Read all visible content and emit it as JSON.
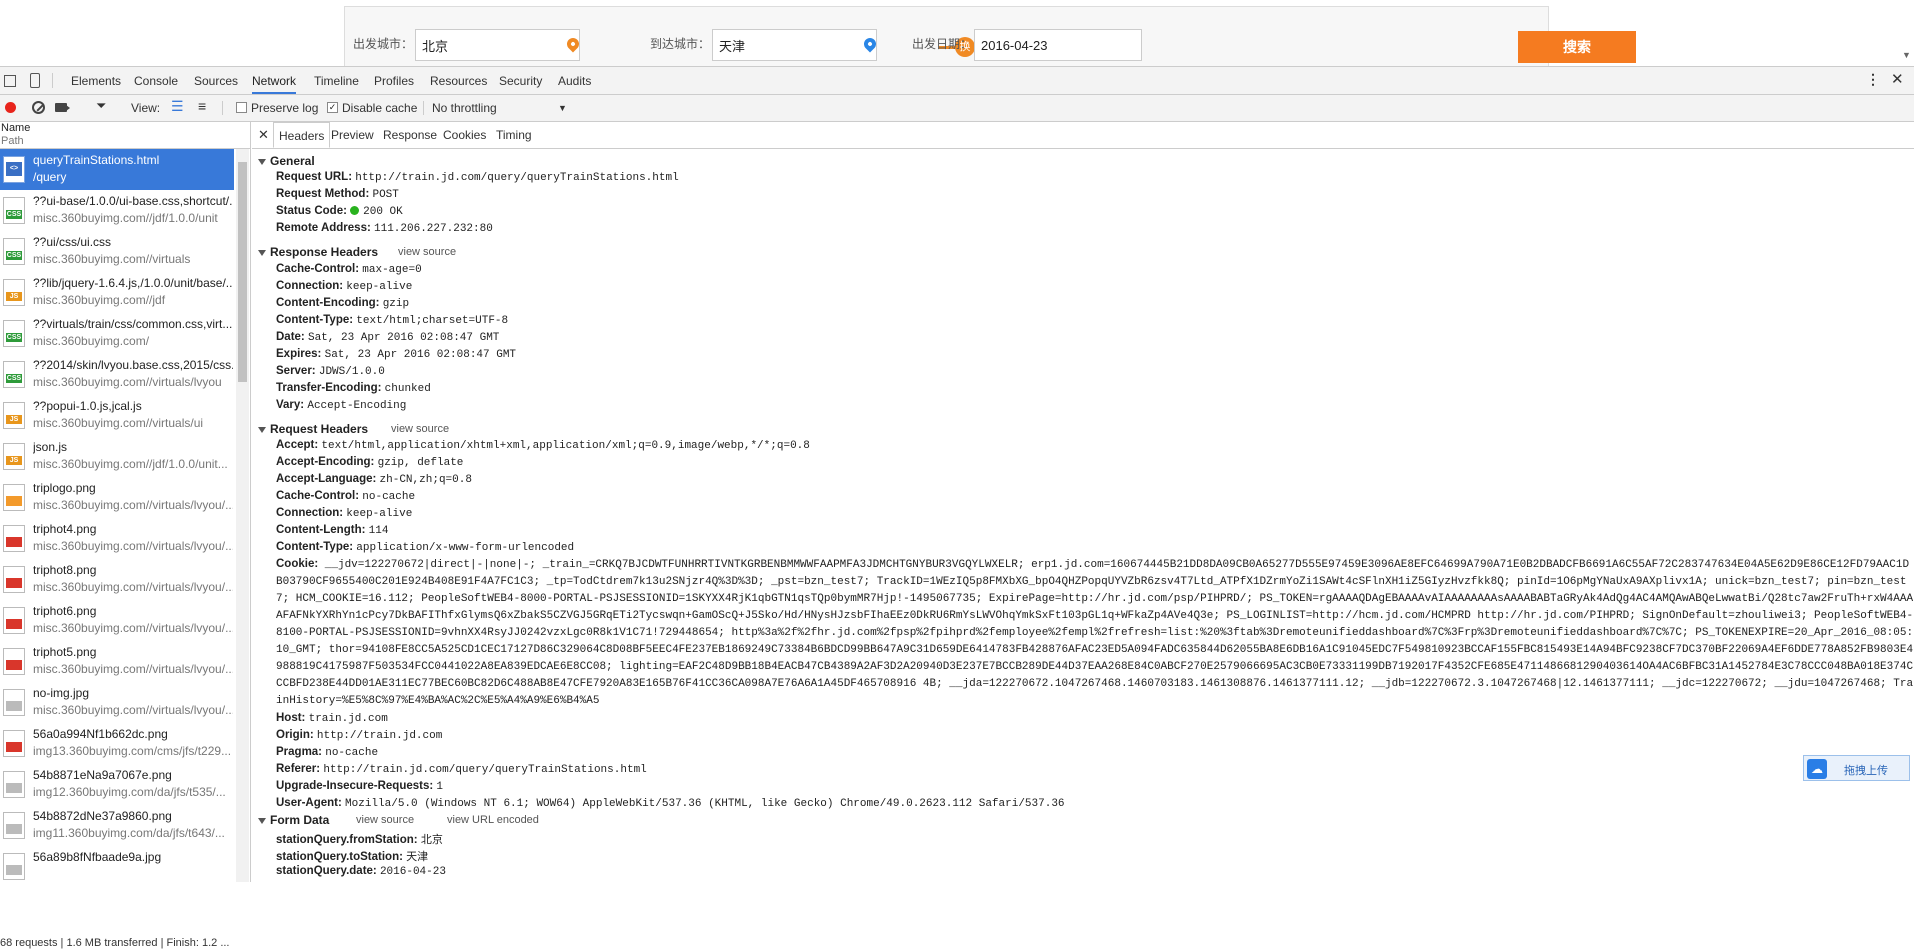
{
  "search": {
    "from_label": "出发城市：",
    "from_value": "北京",
    "swap_label": "换",
    "to_label": "到达城市：",
    "to_value": "天津",
    "date_label": "出发日期：",
    "date_value": "2016-04-23",
    "button_label": "搜索"
  },
  "devtools": {
    "tabs": [
      "Elements",
      "Console",
      "Sources",
      "Network",
      "Timeline",
      "Profiles",
      "Resources",
      "Security",
      "Audits"
    ],
    "active_tab": "Network",
    "toolbar": {
      "view_label": "View:",
      "preserve_log": "Preserve log",
      "disable_cache": "Disable cache",
      "throttling": "No throttling"
    },
    "list_header": {
      "name": "Name",
      "path": "Path"
    },
    "requests": [
      {
        "name": "queryTrainStations.html",
        "path": "/query",
        "type": "html"
      },
      {
        "name": "??ui-base/1.0.0/ui-base.css,shortcut/...",
        "path": "misc.360buyimg.com//jdf/1.0.0/unit",
        "type": "css"
      },
      {
        "name": "??ui/css/ui.css",
        "path": "misc.360buyimg.com//virtuals",
        "type": "css"
      },
      {
        "name": "??lib/jquery-1.6.4.js,/1.0.0/unit/base/...",
        "path": "misc.360buyimg.com//jdf",
        "type": "js"
      },
      {
        "name": "??virtuals/train/css/common.css,virt...",
        "path": "misc.360buyimg.com/",
        "type": "css"
      },
      {
        "name": "??2014/skin/lvyou.base.css,2015/css...",
        "path": "misc.360buyimg.com//virtuals/lvyou",
        "type": "css"
      },
      {
        "name": "??popui-1.0.js,jcal.js",
        "path": "misc.360buyimg.com//virtuals/ui",
        "type": "js"
      },
      {
        "name": "json.js",
        "path": "misc.360buyimg.com//jdf/1.0.0/unit...",
        "type": "js"
      },
      {
        "name": "triplogo.png",
        "path": "misc.360buyimg.com//virtuals/lvyou/...",
        "type": "img-orange"
      },
      {
        "name": "triphot4.png",
        "path": "misc.360buyimg.com//virtuals/lvyou/...",
        "type": "img-red"
      },
      {
        "name": "triphot8.png",
        "path": "misc.360buyimg.com//virtuals/lvyou/...",
        "type": "img-red"
      },
      {
        "name": "triphot6.png",
        "path": "misc.360buyimg.com//virtuals/lvyou/...",
        "type": "img-red"
      },
      {
        "name": "triphot5.png",
        "path": "misc.360buyimg.com//virtuals/lvyou/...",
        "type": "img-red"
      },
      {
        "name": "no-img.jpg",
        "path": "misc.360buyimg.com//virtuals/lvyou/...",
        "type": "img-gray"
      },
      {
        "name": "56a0a994Nf1b662dc.png",
        "path": "img13.360buyimg.com/cms/jfs/t229...",
        "type": "img-red"
      },
      {
        "name": "54b8871eNa9a7067e.png",
        "path": "img12.360buyimg.com/da/jfs/t535/...",
        "type": "img-gray"
      },
      {
        "name": "54b8872dNe37a9860.png",
        "path": "img11.360buyimg.com/da/jfs/t643/...",
        "type": "img-gray"
      },
      {
        "name": "56a89b8fNfbaade9a.jpg",
        "path": "",
        "type": "img-gray"
      }
    ],
    "status": "68 requests  |  1.6 MB transferred  |  Finish: 1.2 ...",
    "detail_tabs": [
      "Headers",
      "Preview",
      "Response",
      "Cookies",
      "Timing"
    ],
    "general": {
      "title": "General",
      "request_url": {
        "k": "Request URL:",
        "v": "http://train.jd.com/query/queryTrainStations.html"
      },
      "request_method": {
        "k": "Request Method:",
        "v": "POST"
      },
      "status_code": {
        "k": "Status Code:",
        "v": "200 OK"
      },
      "remote_address": {
        "k": "Remote Address:",
        "v": "111.206.227.232:80"
      }
    },
    "response_headers": {
      "title": "Response Headers",
      "view_source": "view source",
      "items": [
        {
          "k": "Cache-Control:",
          "v": "max-age=0"
        },
        {
          "k": "Connection:",
          "v": "keep-alive"
        },
        {
          "k": "Content-Encoding:",
          "v": "gzip"
        },
        {
          "k": "Content-Type:",
          "v": "text/html;charset=UTF-8"
        },
        {
          "k": "Date:",
          "v": "Sat, 23 Apr 2016 02:08:47 GMT"
        },
        {
          "k": "Expires:",
          "v": "Sat, 23 Apr 2016 02:08:47 GMT"
        },
        {
          "k": "Server:",
          "v": "JDWS/1.0.0"
        },
        {
          "k": "Transfer-Encoding:",
          "v": "chunked"
        },
        {
          "k": "Vary:",
          "v": "Accept-Encoding"
        }
      ]
    },
    "request_headers": {
      "title": "Request Headers",
      "view_source": "view source",
      "items_top": [
        {
          "k": "Accept:",
          "v": "text/html,application/xhtml+xml,application/xml;q=0.9,image/webp,*/*;q=0.8"
        },
        {
          "k": "Accept-Encoding:",
          "v": "gzip, deflate"
        },
        {
          "k": "Accept-Language:",
          "v": "zh-CN,zh;q=0.8"
        },
        {
          "k": "Cache-Control:",
          "v": "no-cache"
        },
        {
          "k": "Connection:",
          "v": "keep-alive"
        },
        {
          "k": "Content-Length:",
          "v": "114"
        },
        {
          "k": "Content-Type:",
          "v": "application/x-www-form-urlencoded"
        }
      ],
      "cookie_key": "Cookie:",
      "cookie_value": "__jdv=122270672|direct|-|none|-; _train_=CRKQ7BJCDWTFUNHRRTIVNTKGRBENBMMWWFAAPMFA3JDMCHTGNYBUR3VGQYLWXELR; erp1.jd.com=160674445B21DD8DA09CB0A65277D555E97459E3096AE8EFC64699A790A71E0B2DBADCFB6691A6C55AF72C283747634E04A5E62D9E86CE12FD79AAC1DB03790CF9655400C201E924B408E91F4A7FC1C3; _tp=TodCtdrem7k13u2SNjzr4Q%3D%3D; _pst=bzn_test7; TrackID=1WEzIQ5p8FMXbXG_bpO4QHZPopqUYVZbR6zsv4T7Ltd_ATPfX1DZrmYoZi1SAWt4cSFlnXH1iZ5GIyzHvzfkk8Q; pinId=1O6pMgYNaUxA9AXplivx1A; unick=bzn_test7; pin=bzn_test7; HCM_COOKIE=16.112; PeopleSoftWEB4-8000-PORTAL-PSJSESSIONID=1SKYXX4RjK1qbGTN1qsTQp0bymMR7Hjp!-1495067735; ExpirePage=http://hr.jd.com/psp/PIHPRD/; PS_TOKEN=rgAAAAQDAgEBAAAAvAIAAAAAAAAsAAAABABTaGRyAk4AdQg4AC4AMQAwABQeLwwatBi/Q28tc7aw2FruTh+rxW4AAAAFAFNkYXRhYn1cPcy7DkBAFIThfxGlymsQ6xZbakS5CZVGJ5GRqETi2Tycswqn+GamOScQ+J5Sko/Hd/HNysHJzsbFIhaEEz0DkRU6RmYsLWVOhqYmkSxFt103pGL1q+WFkaZp4AVe4Q3e; PS_LOGINLIST=http://hcm.jd.com/HCMPRD http://hr.jd.com/PIHPRD; SignOnDefault=zhouliwei3; PeopleSoftWEB4-8100-PORTAL-PSJSESSIONID=9vhnXX4RsyJJ0242vzxLgc0R8k1V1C71!729448654; http%3a%2f%2fhr.jd.com%2fpsp%2fpihprd%2femployee%2fempl%2frefresh=list:%20%3ftab%3Dremoteunifieddashboard%7C%3Frp%3Dremoteunifieddashboard%7C%7C; PS_TOKENEXPIRE=20_Apr_2016_08:05:10_GMT; thor=94108FE8CC5A525CD1CEC17127D86C329064C8D08BF5EEC4FE237EB1869249C73384B6BDCD99BB647A9C31D659DE6414783FB428876AFAC23ED5A094FADC635844D62055BA8E6DB16A1C91045EDC7F549810923BCCAF155FBC815493E14A94BFC9238CF7DC370BF22069A4EF6DDE778A852FB9803E4988819C4175987F503534FCC0441022A8EA839EDCAE6E8CC08; lighting=EAF2C48D9BB18B4EACB47CB4389A2AF3D2A20940D3E237E7BCCB289DE44D37EAA268E84C0ABCF270E2579066695AC3CB0E73331199DB7192017F4352CFE685E4711486681290403614OA4AC6BFBC31A1452784E3C78CCC048BA018E374CCCBFD238E44DD01AE311EC77BEC60BC82D6C488AB8E47CFE7920A83E165B76F41CC36CA098A7E76A6A1A45DF465708916 4B; __jda=122270672.1047267468.1460703183.1461308876.1461377111.12; __jdb=122270672.3.1047267468|12.1461377111; __jdc=122270672; __jdu=1047267468; TrainHistory=%E5%8C%97%E4%BA%AC%2C%E5%A4%A9%E6%B4%A5",
      "items_bottom": [
        {
          "k": "Host:",
          "v": "train.jd.com"
        },
        {
          "k": "Origin:",
          "v": "http://train.jd.com"
        },
        {
          "k": "Pragma:",
          "v": "no-cache"
        },
        {
          "k": "Referer:",
          "v": "http://train.jd.com/query/queryTrainStations.html"
        },
        {
          "k": "Upgrade-Insecure-Requests:",
          "v": "1"
        },
        {
          "k": "User-Agent:",
          "v": "Mozilla/5.0 (Windows NT 6.1; WOW64) AppleWebKit/537.36 (KHTML, like Gecko) Chrome/49.0.2623.112 Safari/537.36"
        }
      ]
    },
    "form_data": {
      "title": "Form Data",
      "view_source": "view source",
      "view_url_encoded": "view URL encoded",
      "items": [
        {
          "k": "stationQuery.fromStation:",
          "v": "北京"
        },
        {
          "k": "stationQuery.toStation:",
          "v": "天津"
        },
        {
          "k": "stationQuery.date:",
          "v": "2016-04-23"
        }
      ]
    },
    "upload_button": "拖拽上传"
  }
}
